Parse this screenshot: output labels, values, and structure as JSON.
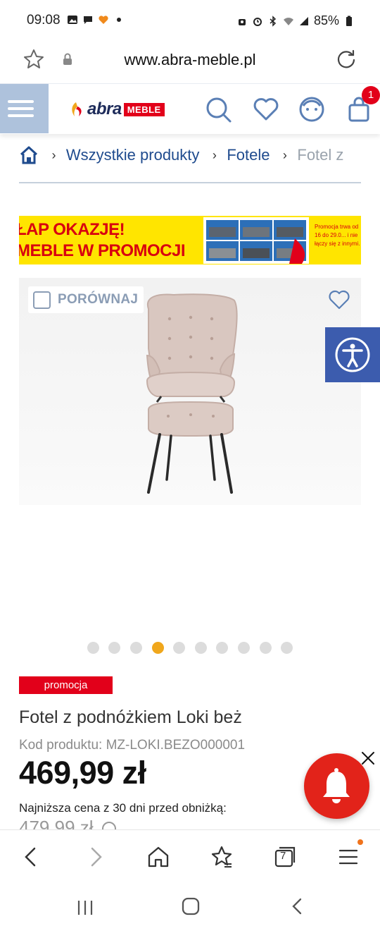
{
  "status_bar": {
    "time": "09:08",
    "battery": "85%",
    "left_icons": [
      "image-icon",
      "chat-icon",
      "heart-app-icon",
      "dot-icon"
    ],
    "right_icons": [
      "vpn-icon",
      "alarm-icon",
      "bluetooth-icon",
      "wifi-icon",
      "signal-icon",
      "battery-icon"
    ]
  },
  "url_bar": {
    "url": "www.abra-meble.pl"
  },
  "header": {
    "logo_text": "abra",
    "logo_tag": "MEBLE",
    "cart_count": "1",
    "icons": [
      "menu-icon",
      "search-icon",
      "heart-icon",
      "account-icon",
      "cart-icon"
    ]
  },
  "breadcrumb": {
    "items": [
      "Wszystkie produkty",
      "Fotele",
      "Fotel z"
    ]
  },
  "banner": {
    "line1": "ŁAP OKAZJĘ!",
    "line2": "MEBLE W PROMOCJI",
    "small": "Promocja trwa od 16 do 29.0... i nie łączy się z innymi."
  },
  "product": {
    "compare_label": "PORÓWNAJ",
    "badge": "promocja",
    "title": "Fotel z podnóżkiem Loki beż",
    "code": "Kod produktu: MZ-LOKI.BEZO000001",
    "price": "469,99 zł",
    "lowest_label": "Najniższa cena z 30 dni przed obniżką:",
    "old_price": "479,99 zł"
  },
  "gallery": {
    "dot_count": 10,
    "active_index": 3
  },
  "browser_nav": {
    "tab_count": "7"
  },
  "colors": {
    "brand_blue": "#1f4b8e",
    "brand_red": "#e2001a",
    "accent_orange": "#f0a71c",
    "menu_bg": "#aec2dc",
    "a11y_bg": "#3c5cae"
  }
}
